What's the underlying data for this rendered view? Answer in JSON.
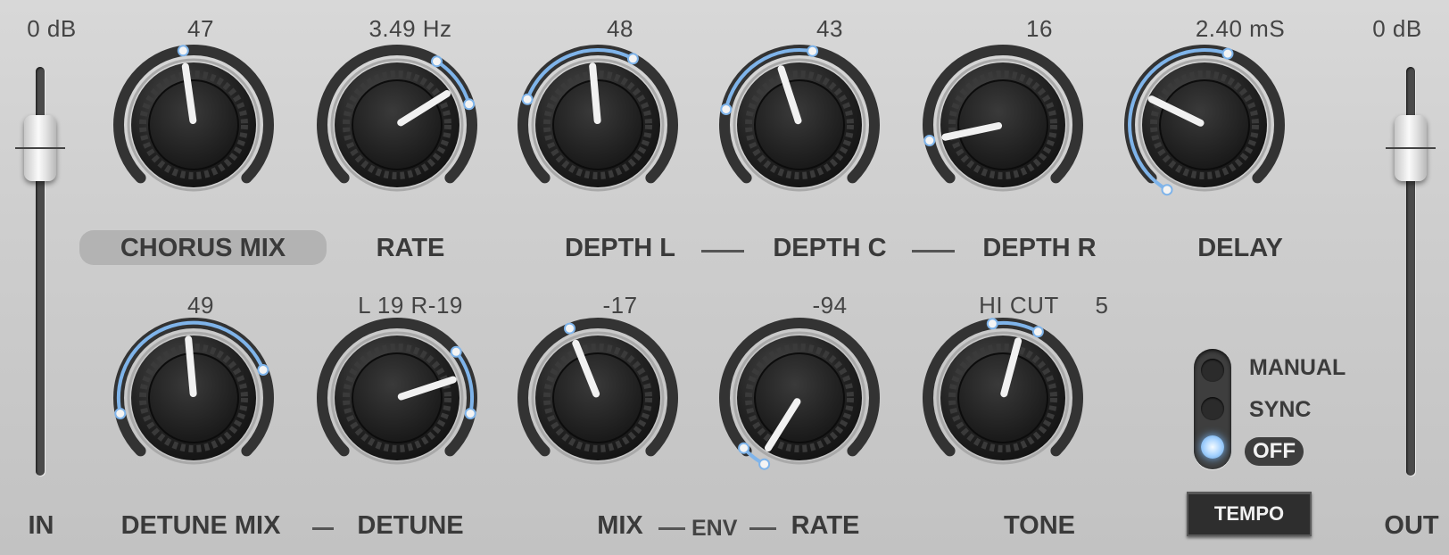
{
  "input": {
    "value": "0 dB",
    "label": "IN"
  },
  "output": {
    "value": "0 dB",
    "label": "OUT"
  },
  "knobs": {
    "chorus_mix": {
      "value": "47",
      "label": "CHORUS MIX"
    },
    "rate": {
      "value": "3.49 Hz",
      "label": "RATE"
    },
    "depth_l": {
      "value": "48",
      "label": "DEPTH L"
    },
    "depth_c": {
      "value": "43",
      "label": "DEPTH C"
    },
    "depth_r": {
      "value": "16",
      "label": "DEPTH R"
    },
    "delay": {
      "value": "2.40 mS",
      "label": "DELAY"
    },
    "detune_mix": {
      "value": "49",
      "label": "DETUNE MIX"
    },
    "detune": {
      "value": "L 19 R-19",
      "label": "DETUNE"
    },
    "env_mix": {
      "value": "-17",
      "label": "MIX"
    },
    "env_rate": {
      "value": "-94",
      "label": "RATE"
    },
    "tone": {
      "value_label": "HI CUT",
      "value": "5",
      "label": "TONE"
    }
  },
  "env_label": "ENV",
  "mode": {
    "options": [
      "MANUAL",
      "SYNC",
      "OFF"
    ],
    "selected": "OFF"
  },
  "tempo_button": "TEMPO",
  "accent_color": "#7fb4ea"
}
